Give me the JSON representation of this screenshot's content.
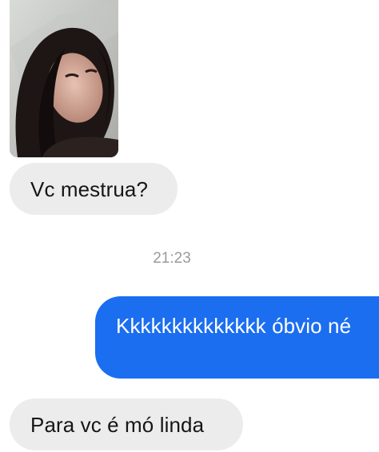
{
  "conversation": {
    "messages": [
      {
        "direction": "incoming",
        "text": "Vc mestrua?"
      },
      {
        "direction": "outgoing",
        "text": "Kkkkkkkkkkkkkk óbvio né"
      },
      {
        "direction": "incoming",
        "text": "Para vc é mó linda"
      }
    ],
    "timestamp": "21:23"
  },
  "colors": {
    "incoming_bubble": "#ececec",
    "outgoing_bubble": "#1b6ef0",
    "timestamp_text": "#9a9a9a"
  },
  "icons": {
    "shared_photo": "photo-of-person"
  }
}
